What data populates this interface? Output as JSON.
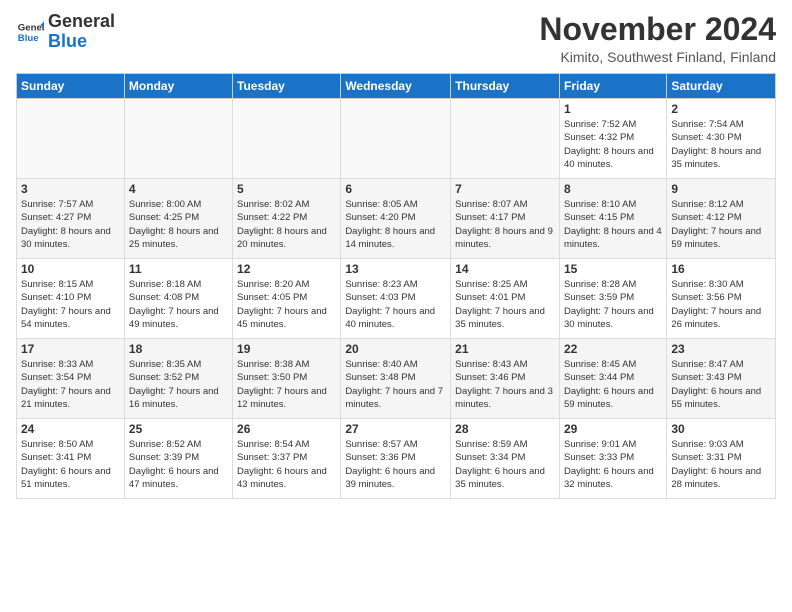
{
  "header": {
    "logo_line1": "General",
    "logo_line2": "Blue",
    "month_title": "November 2024",
    "location": "Kimito, Southwest Finland, Finland"
  },
  "weekdays": [
    "Sunday",
    "Monday",
    "Tuesday",
    "Wednesday",
    "Thursday",
    "Friday",
    "Saturday"
  ],
  "weeks": [
    [
      {
        "day": "",
        "info": ""
      },
      {
        "day": "",
        "info": ""
      },
      {
        "day": "",
        "info": ""
      },
      {
        "day": "",
        "info": ""
      },
      {
        "day": "",
        "info": ""
      },
      {
        "day": "1",
        "info": "Sunrise: 7:52 AM\nSunset: 4:32 PM\nDaylight: 8 hours and 40 minutes."
      },
      {
        "day": "2",
        "info": "Sunrise: 7:54 AM\nSunset: 4:30 PM\nDaylight: 8 hours and 35 minutes."
      }
    ],
    [
      {
        "day": "3",
        "info": "Sunrise: 7:57 AM\nSunset: 4:27 PM\nDaylight: 8 hours and 30 minutes."
      },
      {
        "day": "4",
        "info": "Sunrise: 8:00 AM\nSunset: 4:25 PM\nDaylight: 8 hours and 25 minutes."
      },
      {
        "day": "5",
        "info": "Sunrise: 8:02 AM\nSunset: 4:22 PM\nDaylight: 8 hours and 20 minutes."
      },
      {
        "day": "6",
        "info": "Sunrise: 8:05 AM\nSunset: 4:20 PM\nDaylight: 8 hours and 14 minutes."
      },
      {
        "day": "7",
        "info": "Sunrise: 8:07 AM\nSunset: 4:17 PM\nDaylight: 8 hours and 9 minutes."
      },
      {
        "day": "8",
        "info": "Sunrise: 8:10 AM\nSunset: 4:15 PM\nDaylight: 8 hours and 4 minutes."
      },
      {
        "day": "9",
        "info": "Sunrise: 8:12 AM\nSunset: 4:12 PM\nDaylight: 7 hours and 59 minutes."
      }
    ],
    [
      {
        "day": "10",
        "info": "Sunrise: 8:15 AM\nSunset: 4:10 PM\nDaylight: 7 hours and 54 minutes."
      },
      {
        "day": "11",
        "info": "Sunrise: 8:18 AM\nSunset: 4:08 PM\nDaylight: 7 hours and 49 minutes."
      },
      {
        "day": "12",
        "info": "Sunrise: 8:20 AM\nSunset: 4:05 PM\nDaylight: 7 hours and 45 minutes."
      },
      {
        "day": "13",
        "info": "Sunrise: 8:23 AM\nSunset: 4:03 PM\nDaylight: 7 hours and 40 minutes."
      },
      {
        "day": "14",
        "info": "Sunrise: 8:25 AM\nSunset: 4:01 PM\nDaylight: 7 hours and 35 minutes."
      },
      {
        "day": "15",
        "info": "Sunrise: 8:28 AM\nSunset: 3:59 PM\nDaylight: 7 hours and 30 minutes."
      },
      {
        "day": "16",
        "info": "Sunrise: 8:30 AM\nSunset: 3:56 PM\nDaylight: 7 hours and 26 minutes."
      }
    ],
    [
      {
        "day": "17",
        "info": "Sunrise: 8:33 AM\nSunset: 3:54 PM\nDaylight: 7 hours and 21 minutes."
      },
      {
        "day": "18",
        "info": "Sunrise: 8:35 AM\nSunset: 3:52 PM\nDaylight: 7 hours and 16 minutes."
      },
      {
        "day": "19",
        "info": "Sunrise: 8:38 AM\nSunset: 3:50 PM\nDaylight: 7 hours and 12 minutes."
      },
      {
        "day": "20",
        "info": "Sunrise: 8:40 AM\nSunset: 3:48 PM\nDaylight: 7 hours and 7 minutes."
      },
      {
        "day": "21",
        "info": "Sunrise: 8:43 AM\nSunset: 3:46 PM\nDaylight: 7 hours and 3 minutes."
      },
      {
        "day": "22",
        "info": "Sunrise: 8:45 AM\nSunset: 3:44 PM\nDaylight: 6 hours and 59 minutes."
      },
      {
        "day": "23",
        "info": "Sunrise: 8:47 AM\nSunset: 3:43 PM\nDaylight: 6 hours and 55 minutes."
      }
    ],
    [
      {
        "day": "24",
        "info": "Sunrise: 8:50 AM\nSunset: 3:41 PM\nDaylight: 6 hours and 51 minutes."
      },
      {
        "day": "25",
        "info": "Sunrise: 8:52 AM\nSunset: 3:39 PM\nDaylight: 6 hours and 47 minutes."
      },
      {
        "day": "26",
        "info": "Sunrise: 8:54 AM\nSunset: 3:37 PM\nDaylight: 6 hours and 43 minutes."
      },
      {
        "day": "27",
        "info": "Sunrise: 8:57 AM\nSunset: 3:36 PM\nDaylight: 6 hours and 39 minutes."
      },
      {
        "day": "28",
        "info": "Sunrise: 8:59 AM\nSunset: 3:34 PM\nDaylight: 6 hours and 35 minutes."
      },
      {
        "day": "29",
        "info": "Sunrise: 9:01 AM\nSunset: 3:33 PM\nDaylight: 6 hours and 32 minutes."
      },
      {
        "day": "30",
        "info": "Sunrise: 9:03 AM\nSunset: 3:31 PM\nDaylight: 6 hours and 28 minutes."
      }
    ]
  ]
}
